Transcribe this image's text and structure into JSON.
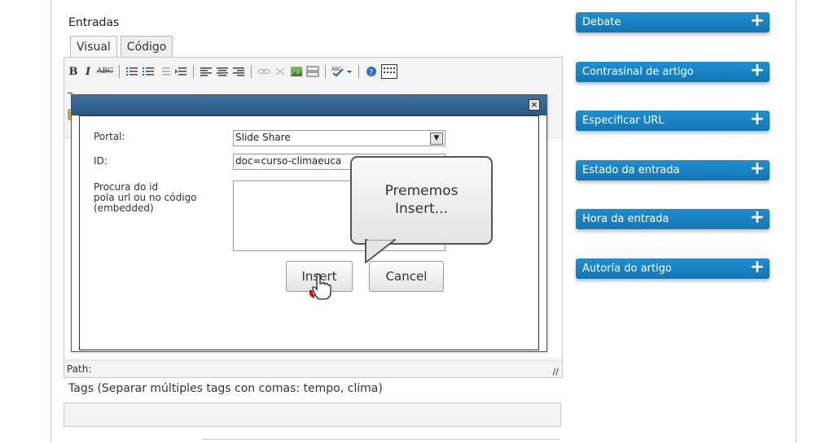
{
  "editor": {
    "section_title": "Entradas",
    "tabs": [
      {
        "label": "Visual"
      },
      {
        "label": "Código"
      }
    ],
    "toolbar_bold": "B",
    "toolbar_italic": "I",
    "toolbar_strike": "ABC",
    "status_path": "Path:"
  },
  "dialog": {
    "close_label": "×",
    "portal_label": "Portal:",
    "portal_value": "Slide Share",
    "id_label": "ID:",
    "id_value": "doc=curso-climaeuca",
    "search_label_1": "Procura do id",
    "search_label_2": "pola url ou no código",
    "search_label_3": "(embedded)",
    "insert_label": "Insert",
    "cancel_label": "Cancel"
  },
  "callout": {
    "line1": "Prememos",
    "line2": "Insert..."
  },
  "tags": {
    "label": "Tags (Separar múltiples tags con comas: tempo, clima)"
  },
  "sidebar": {
    "items": [
      {
        "label": "Debate"
      },
      {
        "label": "Contrasinal de artigo"
      },
      {
        "label": "Especificar URL"
      },
      {
        "label": "Estado da entrada"
      },
      {
        "label": "Hora da entrada"
      },
      {
        "label": "Autoría do artigo"
      }
    ],
    "plus": "+"
  },
  "colors": {
    "sidebar_button": "#1a83c4",
    "dialog_title": "#2f618f"
  }
}
